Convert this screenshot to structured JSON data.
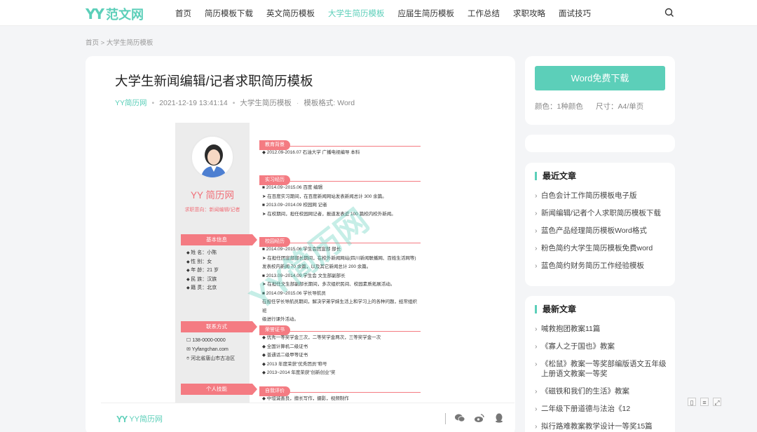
{
  "header": {
    "logo_mark": "YY",
    "logo_text": "范文网",
    "nav": [
      "首页",
      "简历模板下载",
      "英文简历模板",
      "大学生简历模板",
      "应届生简历模板",
      "工作总结",
      "求职攻略",
      "面试技巧"
    ],
    "active_nav": "大学生简历模板"
  },
  "breadcrumb": "首页 > 大学生简历模板",
  "article": {
    "title": "大学生新闻编辑/记者求职简历模板",
    "site": "YY简历网",
    "datetime": "2021-12-19 13:41:14",
    "category": "大学生简历模板",
    "format": "模板格式: Word"
  },
  "resume": {
    "brand": "YY 简历网",
    "intent": "求职意向：新闻编辑/记者",
    "labels": {
      "basic": "基本信息",
      "contact": "联系方式",
      "skills": "个人技能",
      "education": "教育背景",
      "internship": "实习经历",
      "campus": "校园经历",
      "certs": "荣誉证书",
      "self": "自我评价"
    },
    "basic_info": [
      "姓 名：小陈",
      "性 别：女",
      "年 龄：21 岁",
      "民 族：汉族",
      "籍 贯：北京"
    ],
    "contact": [
      "138-0000-0000",
      "Yyfangchan.com",
      "河北省唐山市古冶区"
    ],
    "education": [
      "◆  2012.09-2016.07     石油大学     广播电视编导     本科"
    ],
    "internship": [
      "■  2014.09~2015.06        百度             编辑",
      "➤  在百度实习期间，在百度新闻网站发表新闻总计 300 余篇。",
      "■  2013.09~2014.09        校园网           记者",
      "➤  在校期间，担任校园网记者，报道发表近 100 篇校内校外新闻。"
    ],
    "campus": [
      "■  2014.09~2015.06        学生会团宣部        部长",
      "➤  在担任团宣部部长期间，在校外新闻网站(四川新闻联播网、百姓生活网等)",
      "    发表校内新闻 70 余篇，以及其它新闻总计 200 余篇。",
      "■  2013.09~2014.09        学生会            文生部副部长",
      "➤  在担任文生部副部长期间，多次组织民间、校园素质拓展活动。",
      "■  2014.09~2015.06        学长导航员",
      "在担任学长导航员期间，解决学弟学妹生活上和学习上的各种问题，经常组织班",
      "级进行课外活动。"
    ],
    "certs": [
      "◆  优秀一等奖学金三次，二等奖学金两次，三等奖学金一次",
      "◆  全国计算机二级证书",
      "◆  普通话二级甲等证书",
      "◆  2013 年度荣获\"优秀团员\"称号",
      "◆  2013~2014 年度荣获\"创新创业\"奖"
    ],
    "self_eval": [
      "◆  中坦诚善良，擅长写作，摄影，视频制作"
    ],
    "watermark": "YY简历网"
  },
  "bottombar": {
    "logo_mark": "YY",
    "logo_text": "YY简历网"
  },
  "sidebar": {
    "download_label": "Word免费下载",
    "color_label": "颜色：1种颜色",
    "size_label": "尺寸：A4/单页",
    "recent_title": "最近文章",
    "recent": [
      "白色会计工作简历模板电子版",
      "新闻编辑/记者个人求职简历模板下载",
      "蓝色产品经理简历模板Word格式",
      "粉色简约大学生简历模板免费word",
      "蓝色简约财务简历工作经验模板"
    ],
    "latest_title": "最新文章",
    "latest": [
      "喊救抱团教案11篇",
      "《寡人之于国也》教案",
      "《松鼠》教案一等奖部编版语文五年级上册语文教案一等奖",
      "《磁铁和我们的生活》教案",
      "二年级下册道德与法治《12",
      "拟行路难教案教学设计一等奖15篇"
    ]
  },
  "colors": {
    "accent": "#5ccfb9",
    "resume_pink": "#f47b82"
  }
}
